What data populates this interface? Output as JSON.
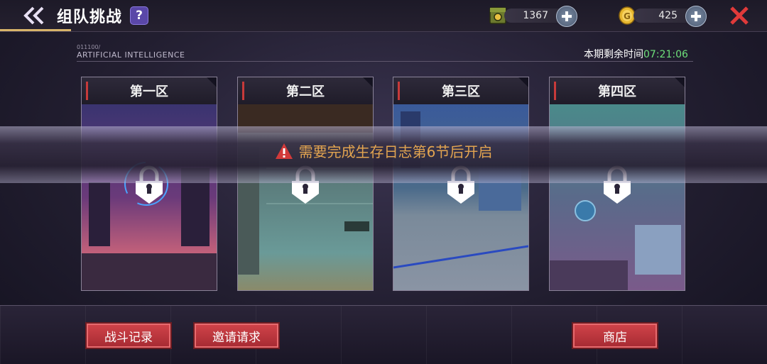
{
  "header": {
    "title": "组队挑战",
    "help_label": "?",
    "currencies": [
      {
        "name": "ammo",
        "value": "1367",
        "icon": "ammo-box-icon"
      },
      {
        "name": "gold",
        "value": "425",
        "icon": "gold-coin-icon"
      }
    ]
  },
  "subheader": {
    "code": "011100/",
    "label": "ARTIFICIAL INTELLIGENCE",
    "timer_label": "本期剩余时间",
    "timer_value": "07:21:06"
  },
  "zones": [
    {
      "label": "第一区",
      "locked": true
    },
    {
      "label": "第二区",
      "locked": true
    },
    {
      "label": "第三区",
      "locked": true
    },
    {
      "label": "第四区",
      "locked": true
    }
  ],
  "banner": {
    "message": "需要完成生存日志第6节后开启"
  },
  "buttons": {
    "battle_record": "战斗记录",
    "invite_request": "邀请请求",
    "shop": "商店"
  },
  "colors": {
    "accent_red": "#c73a3a",
    "timer_green": "#6ee07a",
    "warning_orange": "#e2a450",
    "help_purple": "#5a47a8"
  }
}
